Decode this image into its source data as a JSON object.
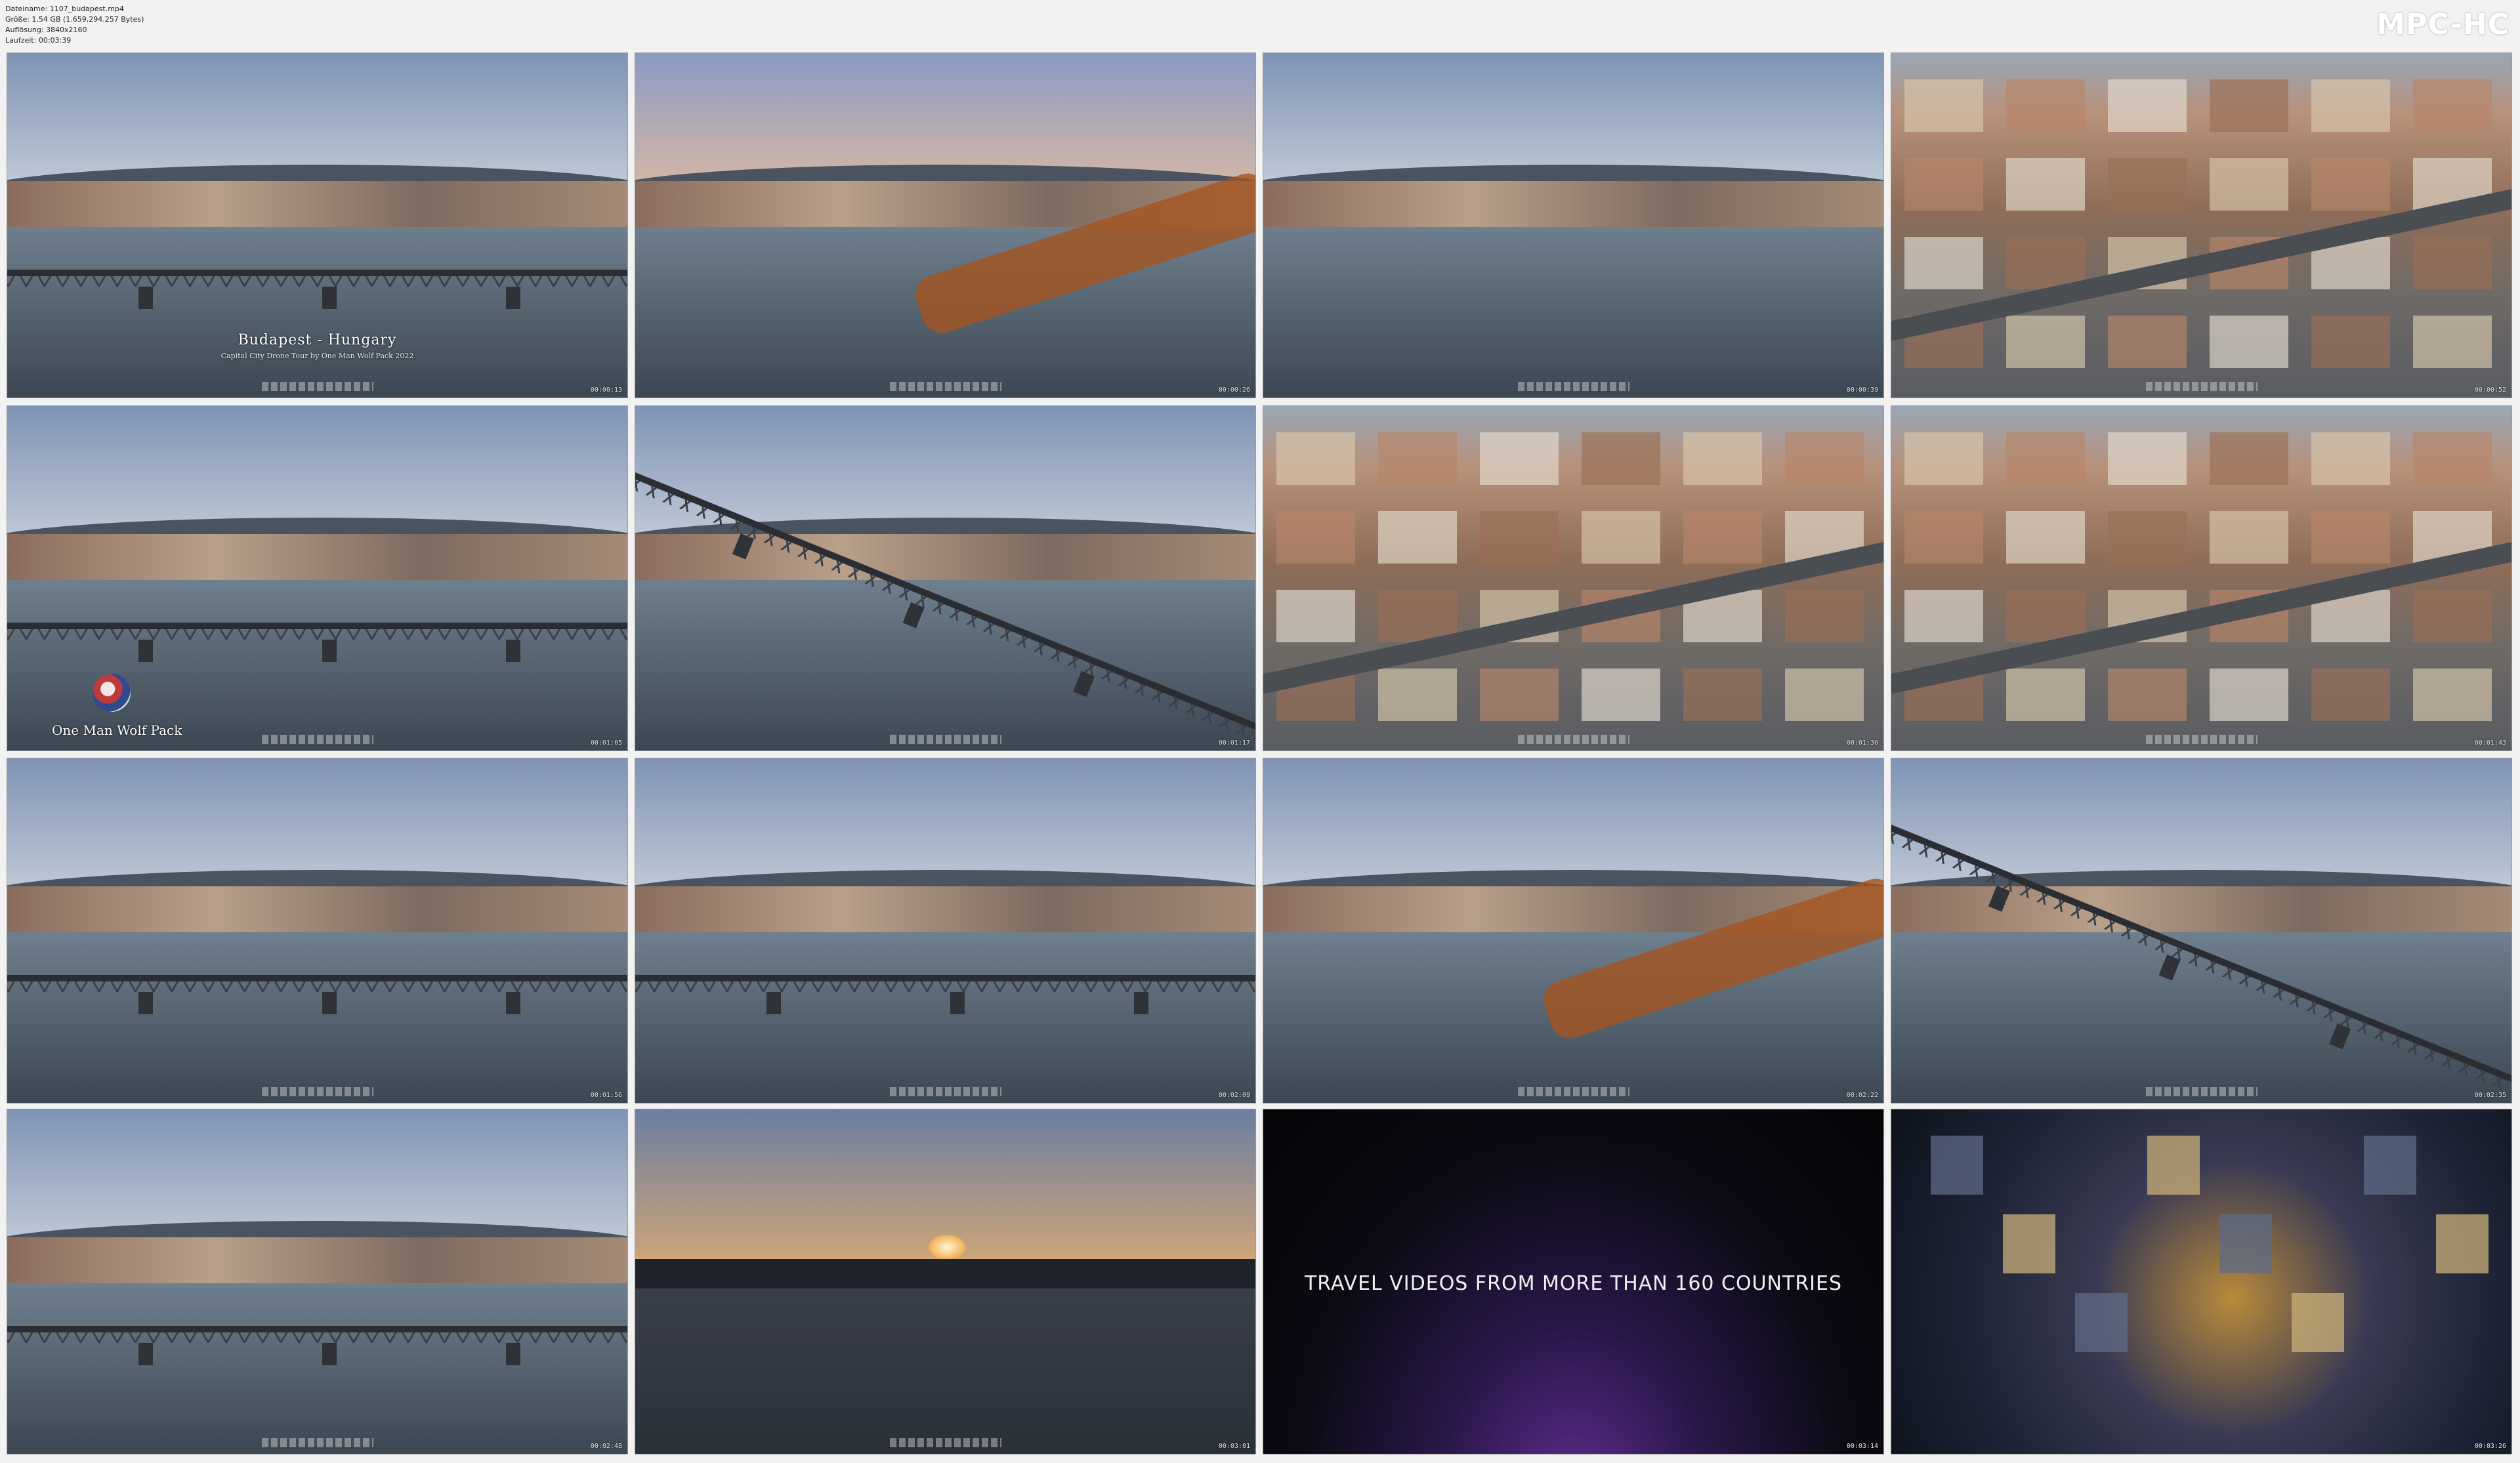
{
  "header": {
    "meta_lines": [
      "Dateiname: 1107_budapest.mp4",
      "Größe: 1.54 GB (1.659,294.257 Bytes)",
      "Auflösung: 3840x2160",
      "Laufzeit: 00:03:39"
    ],
    "brand": "MPC-HC"
  },
  "overlays": {
    "title_line1": "Budapest - Hungary",
    "title_line2": "Capital City Drone Tour by One Man Wolf Pack 2022",
    "channel": "One Man Wolf Pack",
    "travel_text": "TRAVEL VIDEOS FROM MORE THAN 160 COUNTRIES"
  },
  "thumbnails": [
    {
      "time": "00:00:13",
      "scene": "bridge-dusk"
    },
    {
      "time": "00:00:26",
      "scene": "embankment-autumn"
    },
    {
      "time": "00:00:39",
      "scene": "river-city"
    },
    {
      "time": "00:00:52",
      "scene": "city-top"
    },
    {
      "time": "00:01:05",
      "scene": "bridge-hazy"
    },
    {
      "time": "00:01:17",
      "scene": "bridge-aerial"
    },
    {
      "time": "00:01:30",
      "scene": "city-junction"
    },
    {
      "time": "00:01:43",
      "scene": "city-square"
    },
    {
      "time": "00:01:56",
      "scene": "bridge-dusk"
    },
    {
      "time": "00:02:09",
      "scene": "river-bridge"
    },
    {
      "time": "00:02:22",
      "scene": "river-embankment"
    },
    {
      "time": "00:02:35",
      "scene": "bridge-aerial"
    },
    {
      "time": "00:02:48",
      "scene": "river-bridge"
    },
    {
      "time": "00:03:01",
      "scene": "sunset"
    },
    {
      "time": "00:03:14",
      "scene": "title-card"
    },
    {
      "time": "00:03:26",
      "scene": "night-city"
    }
  ],
  "colors": {
    "sky_dusk": "#9fb3cf",
    "sky_day": "#b9c6d6",
    "river": "#4d5b67",
    "city_warm": "#b58a6a",
    "foliage": "#a5541f"
  }
}
